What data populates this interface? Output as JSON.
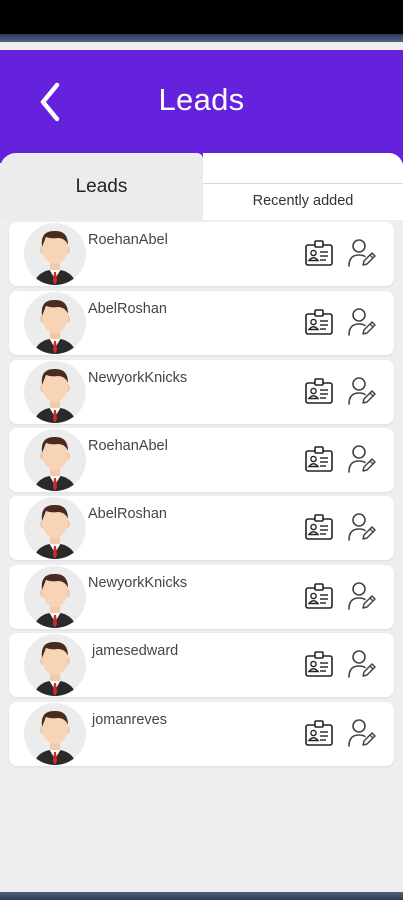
{
  "header": {
    "title": "Leads"
  },
  "tabs": [
    {
      "label": "Leads",
      "active": true
    },
    {
      "label": "Recently added",
      "active": false
    }
  ],
  "leads": [
    {
      "name": "RoehanAbel"
    },
    {
      "name": "AbelRoshan"
    },
    {
      "name": "NewyorkKnicks"
    },
    {
      "name": "RoehanAbel"
    },
    {
      "name": "AbelRoshan"
    },
    {
      "name": "NewyorkKnicks"
    },
    {
      "name": "jamesedward"
    },
    {
      "name": "jomanreves"
    }
  ],
  "icons": {
    "back": "chevron-left-icon",
    "contact_card": "id-card-icon",
    "edit_user": "user-edit-icon",
    "avatar": "avatar-icon"
  },
  "colors": {
    "header": "#6522dc",
    "background": "#eeeeee"
  }
}
